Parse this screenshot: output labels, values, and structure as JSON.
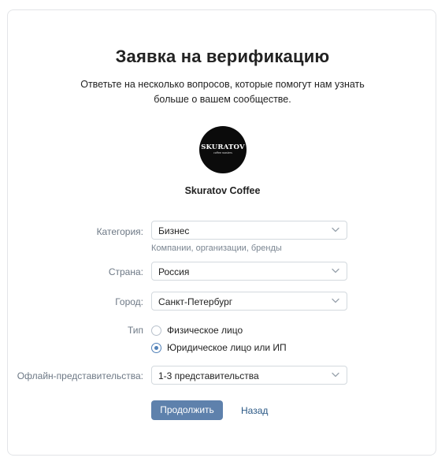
{
  "header": {
    "title": "Заявка на верификацию",
    "subtitle": "Ответьте на несколько вопросов, которые помогут нам узнать больше о вашем сообществе."
  },
  "community": {
    "avatar_logo_main": "SKURATOV",
    "avatar_logo_sub": "coffee roasters",
    "name": "Skuratov Coffee"
  },
  "form": {
    "category": {
      "label": "Категория:",
      "value": "Бизнес",
      "hint": "Компании, организации, бренды"
    },
    "country": {
      "label": "Страна:",
      "value": "Россия"
    },
    "city": {
      "label": "Город:",
      "value": "Санкт-Петербург"
    },
    "type": {
      "label": "Тип",
      "options": [
        {
          "label": "Физическое лицо",
          "selected": false
        },
        {
          "label": "Юридическое лицо или ИП",
          "selected": true
        }
      ]
    },
    "offline": {
      "label": "Офлайн-представительства:",
      "value": "1-3 представительства"
    }
  },
  "actions": {
    "continue_label": "Продолжить",
    "back_label": "Назад"
  },
  "colors": {
    "accent": "#5e81ac",
    "link": "#2a5885",
    "radio_selected": "#5181b8"
  },
  "icons": {
    "select_arrow": "chevron-down-icon"
  }
}
